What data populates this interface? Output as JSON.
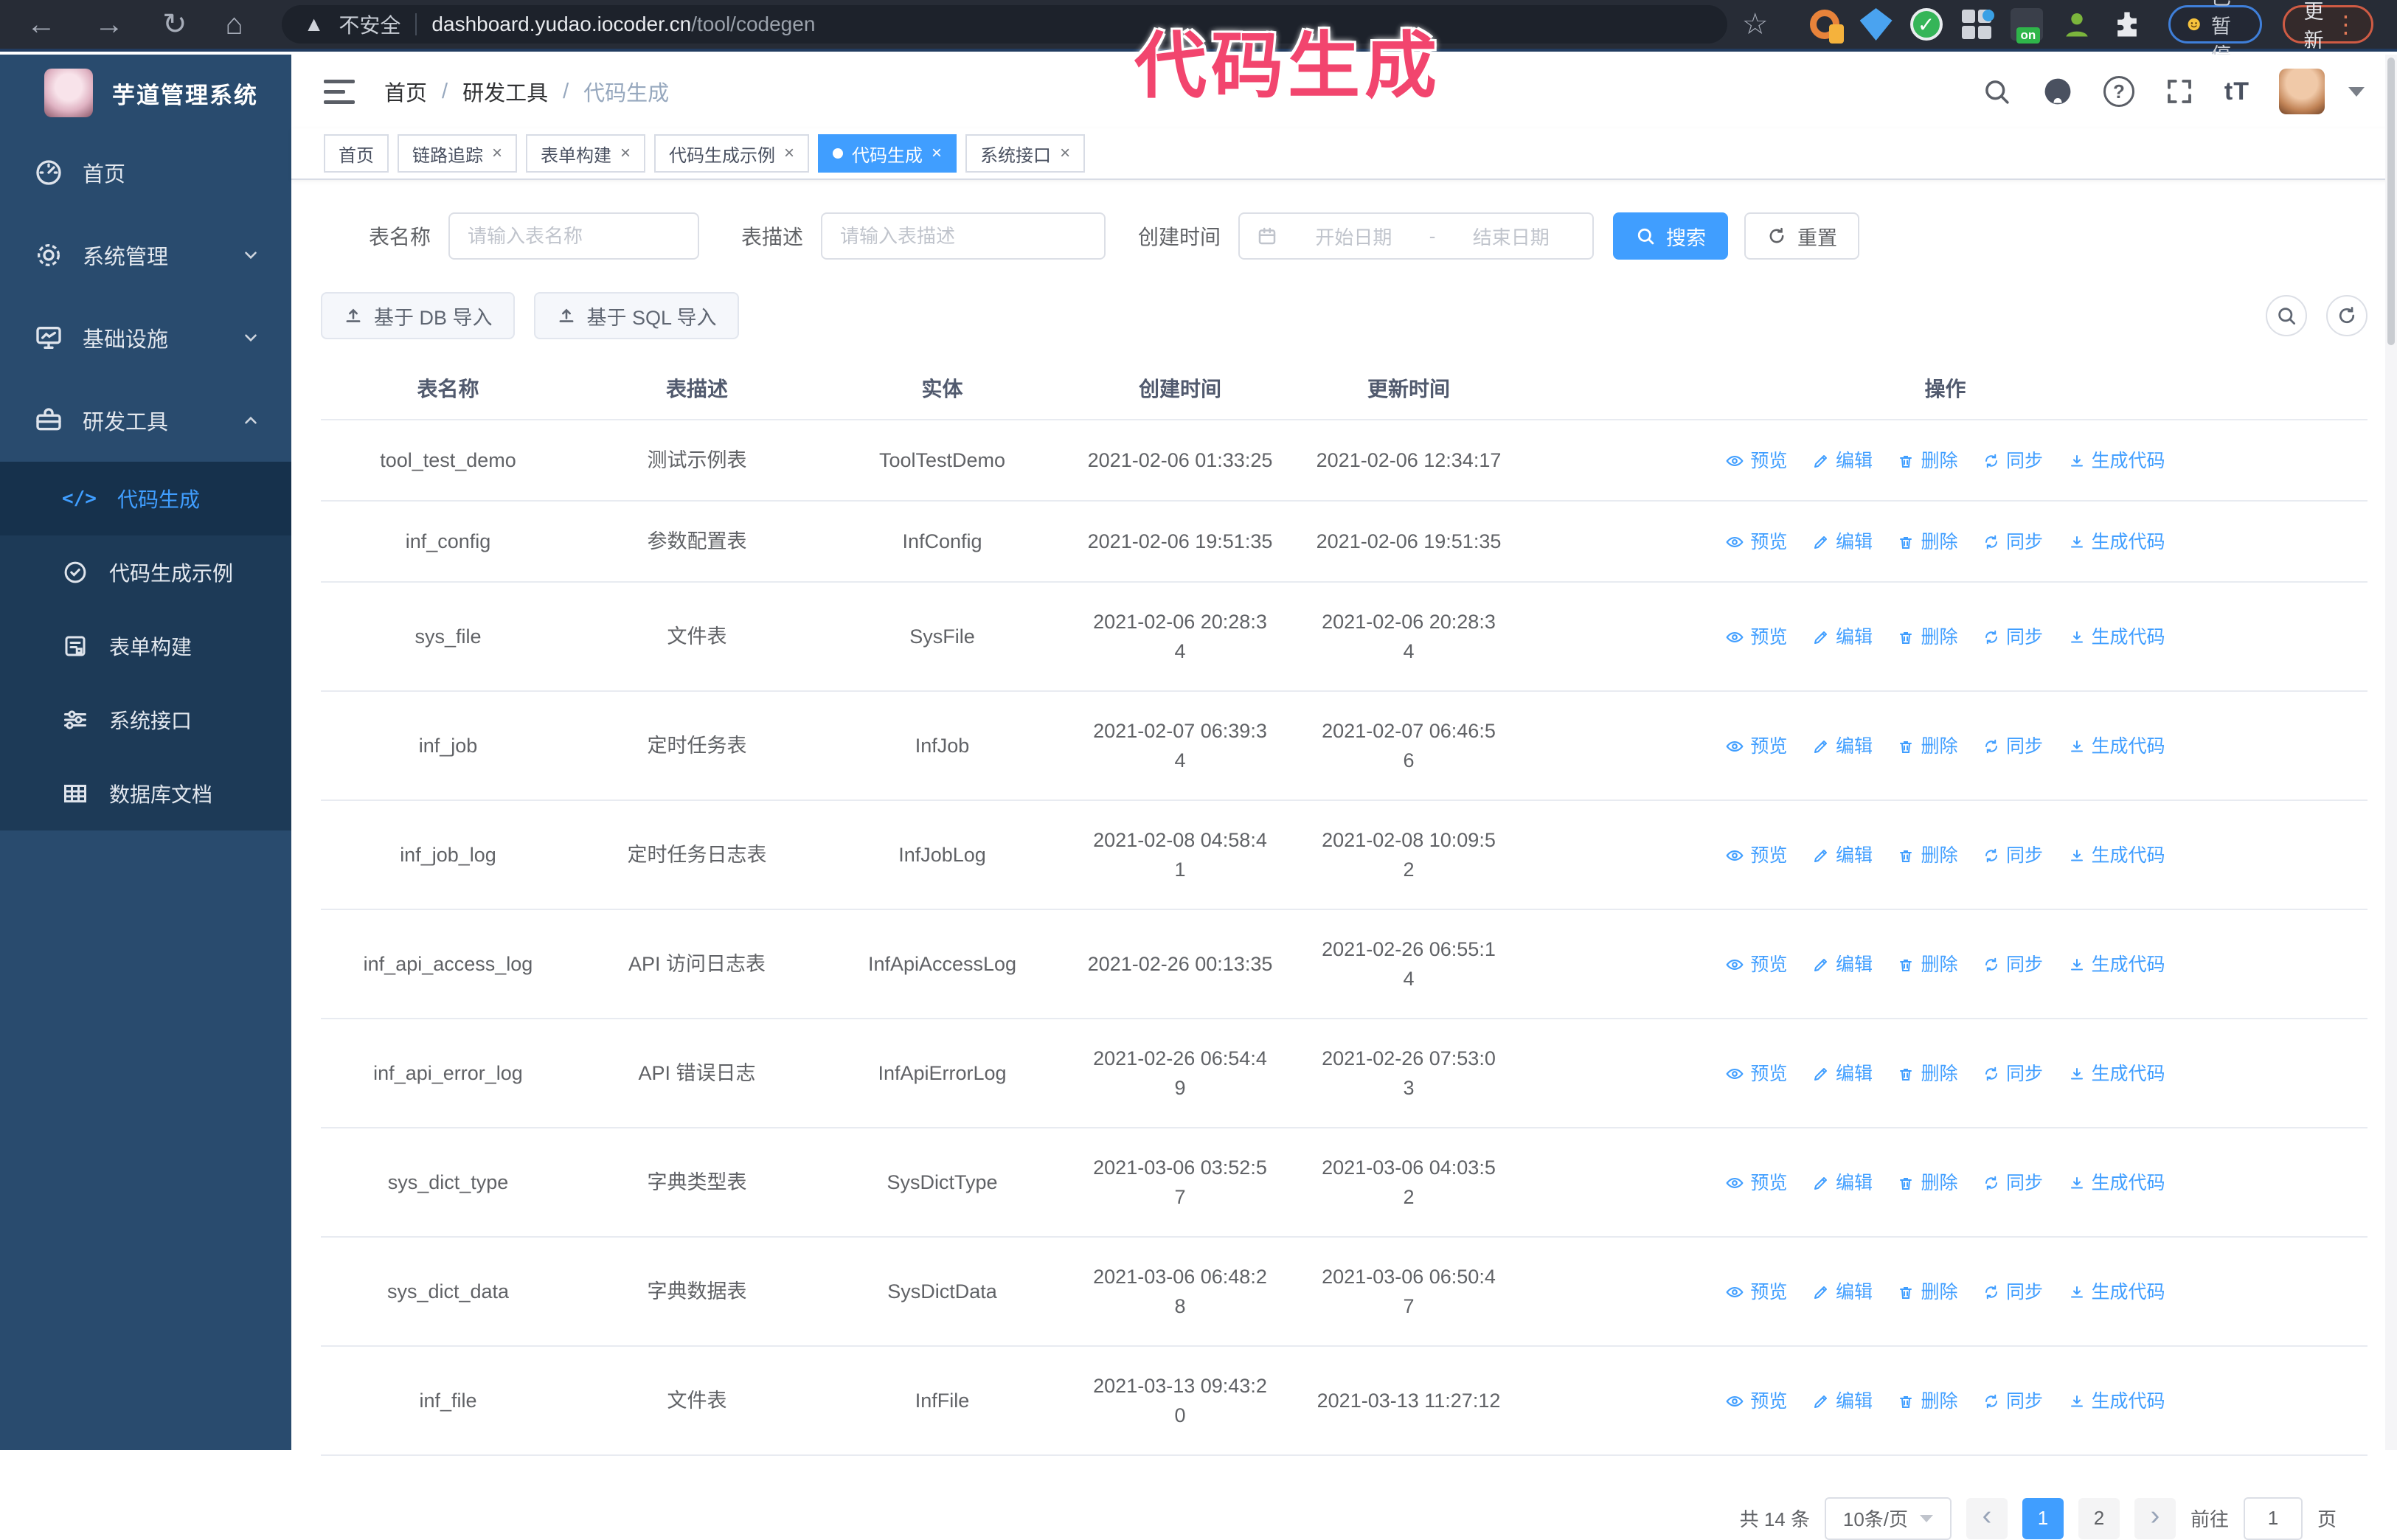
{
  "browser": {
    "security_label": "不安全",
    "url_domain": "dashboard.yudao.iocoder.cn",
    "url_path": "/tool/codegen",
    "paused_label": "已暂停",
    "update_label": "更新"
  },
  "annotation": {
    "text": "代码生成",
    "color": "#f2456e"
  },
  "sidebar": {
    "title": "芋道管理系统",
    "items": [
      {
        "label": "首页",
        "expandable": false
      },
      {
        "label": "系统管理",
        "expandable": true,
        "expanded": false
      },
      {
        "label": "基础设施",
        "expandable": true,
        "expanded": false
      },
      {
        "label": "研发工具",
        "expandable": true,
        "expanded": true
      }
    ],
    "subitems": [
      {
        "label": "代码生成",
        "active": true
      },
      {
        "label": "代码生成示例",
        "active": false
      },
      {
        "label": "表单构建",
        "active": false
      },
      {
        "label": "系统接口",
        "active": false
      },
      {
        "label": "数据库文档",
        "active": false
      }
    ]
  },
  "breadcrumb": {
    "items": [
      "首页",
      "研发工具",
      "代码生成"
    ],
    "separator": "/"
  },
  "tabs": [
    {
      "label": "首页",
      "closable": false,
      "active": false
    },
    {
      "label": "链路追踪",
      "closable": true,
      "active": false
    },
    {
      "label": "表单构建",
      "closable": true,
      "active": false
    },
    {
      "label": "代码生成示例",
      "closable": true,
      "active": false
    },
    {
      "label": "代码生成",
      "closable": true,
      "active": true
    },
    {
      "label": "系统接口",
      "closable": true,
      "active": false
    }
  ],
  "filters": {
    "name_label": "表名称",
    "name_placeholder": "请输入表名称",
    "desc_label": "表描述",
    "desc_placeholder": "请输入表描述",
    "time_label": "创建时间",
    "start_placeholder": "开始日期",
    "range_separator": "-",
    "end_placeholder": "结束日期",
    "search_label": "搜索",
    "reset_label": "重置"
  },
  "toolbar": {
    "db_import_label": "基于 DB 导入",
    "sql_import_label": "基于 SQL 导入"
  },
  "table": {
    "columns": [
      "表名称",
      "表描述",
      "实体",
      "创建时间",
      "更新时间",
      "操作"
    ],
    "actions": [
      "预览",
      "编辑",
      "删除",
      "同步",
      "生成代码"
    ],
    "rows": [
      {
        "name": "tool_test_demo",
        "desc": "测试示例表",
        "entity": "ToolTestDemo",
        "created": "2021-02-06 01:33:25",
        "updated": "2021-02-06 12:34:17"
      },
      {
        "name": "inf_config",
        "desc": "参数配置表",
        "entity": "InfConfig",
        "created": "2021-02-06 19:51:35",
        "updated": "2021-02-06 19:51:35"
      },
      {
        "name": "sys_file",
        "desc": "文件表",
        "entity": "SysFile",
        "created": "2021-02-06 20:28:3\n4",
        "updated": "2021-02-06 20:28:3\n4"
      },
      {
        "name": "inf_job",
        "desc": "定时任务表",
        "entity": "InfJob",
        "created": "2021-02-07 06:39:3\n4",
        "updated": "2021-02-07 06:46:5\n6"
      },
      {
        "name": "inf_job_log",
        "desc": "定时任务日志表",
        "entity": "InfJobLog",
        "created": "2021-02-08 04:58:4\n1",
        "updated": "2021-02-08 10:09:5\n2"
      },
      {
        "name": "inf_api_access_log",
        "desc": "API 访问日志表",
        "entity": "InfApiAccessLog",
        "created": "2021-02-26 00:13:35",
        "updated": "2021-02-26 06:55:1\n4"
      },
      {
        "name": "inf_api_error_log",
        "desc": "API 错误日志",
        "entity": "InfApiErrorLog",
        "created": "2021-02-26 06:54:4\n9",
        "updated": "2021-02-26 07:53:0\n3"
      },
      {
        "name": "sys_dict_type",
        "desc": "字典类型表",
        "entity": "SysDictType",
        "created": "2021-03-06 03:52:5\n7",
        "updated": "2021-03-06 04:03:5\n2"
      },
      {
        "name": "sys_dict_data",
        "desc": "字典数据表",
        "entity": "SysDictData",
        "created": "2021-03-06 06:48:2\n8",
        "updated": "2021-03-06 06:50:4\n7"
      },
      {
        "name": "inf_file",
        "desc": "文件表",
        "entity": "InfFile",
        "created": "2021-03-13 09:43:2\n0",
        "updated": "2021-03-13 11:27:12"
      }
    ]
  },
  "pagination": {
    "total_label": "共 14 条",
    "page_size_label": "10条/页",
    "prev_glyph": "‹",
    "next_glyph": "›",
    "pages": [
      "1",
      "2"
    ],
    "active_page": "1",
    "goto_label": "前往",
    "goto_value": "1",
    "unit_label": "页"
  },
  "colors": {
    "primary": "#409eff",
    "sidebar_bg": "#294b6e",
    "submenu_bg": "#1d3a57",
    "annotation": "#f2456e"
  }
}
